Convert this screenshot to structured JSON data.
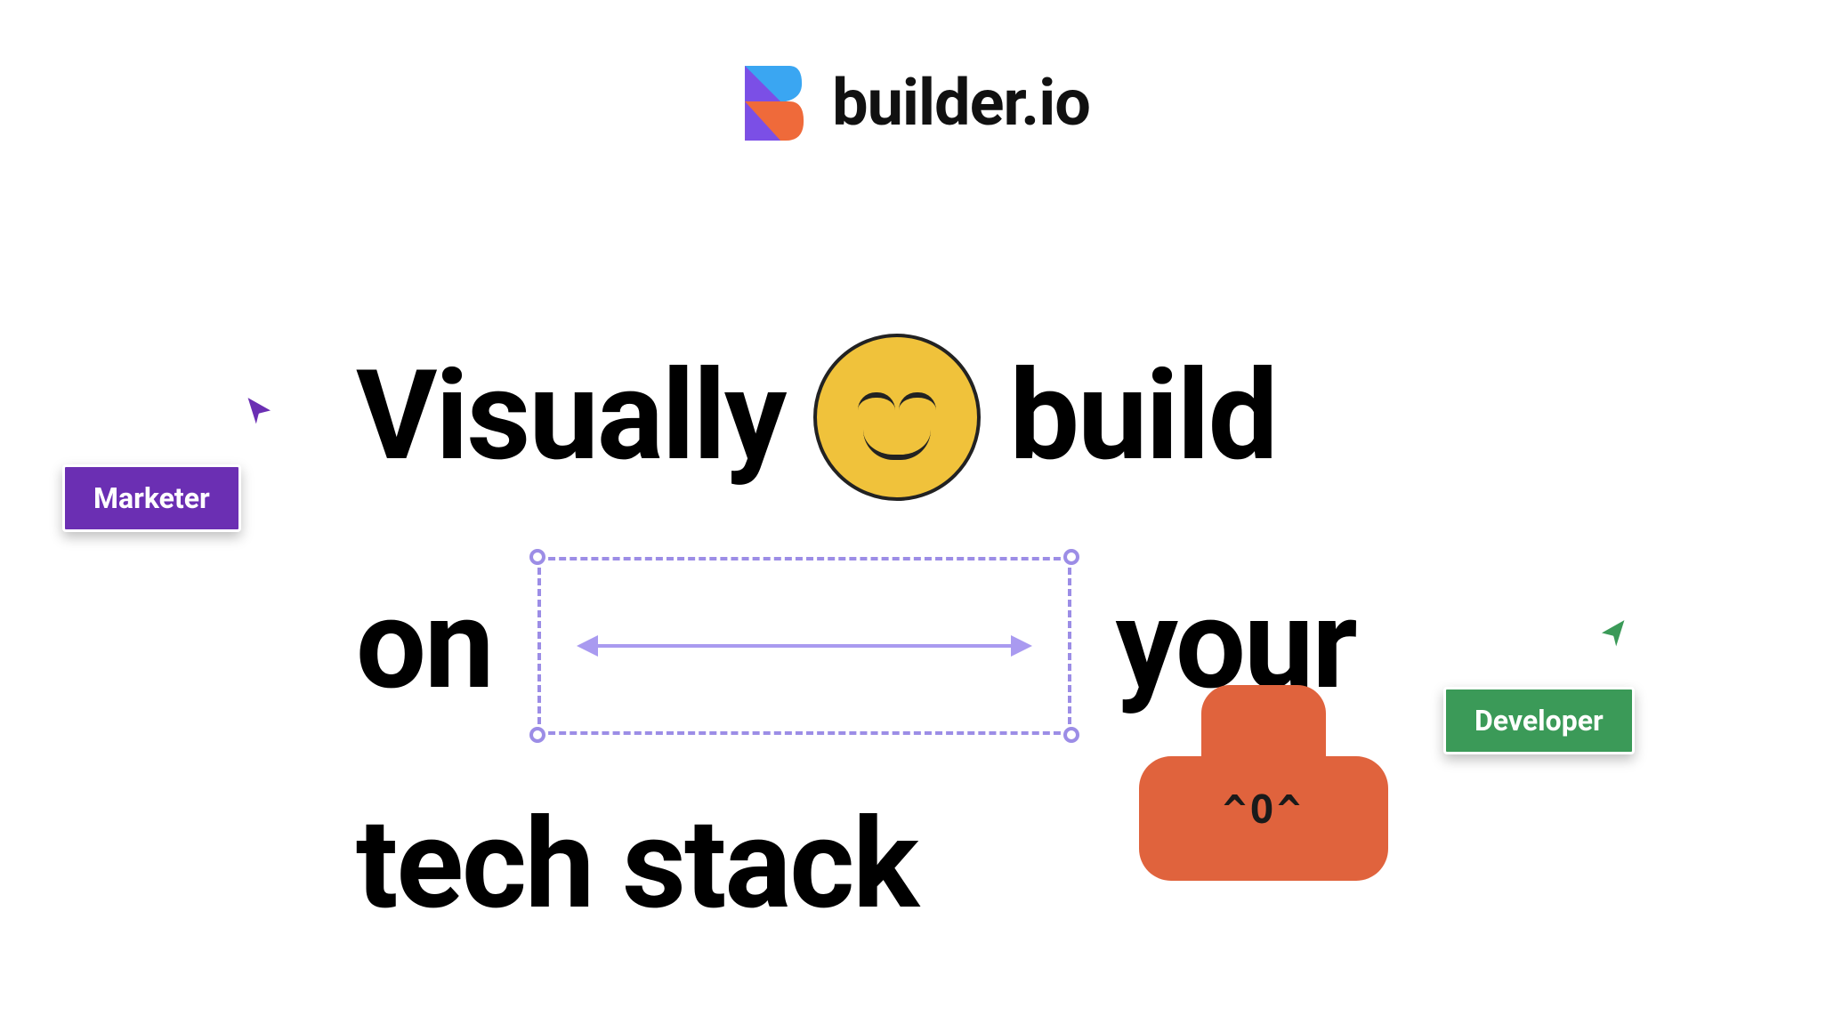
{
  "brand": {
    "name": "builder.io",
    "logo_colors": {
      "blue": "#3aa6f2",
      "purple": "#7b4fe6",
      "orange": "#ef6a3a"
    }
  },
  "headline": {
    "word1": "Visually",
    "word2": "build",
    "word3": "on",
    "word4": "your",
    "word5_6": "tech stack"
  },
  "blob": {
    "face_text": "^O^"
  },
  "cursors": {
    "marketer": {
      "label": "Marketer",
      "color": "#6b2fb3"
    },
    "developer": {
      "label": "Developer",
      "color": "#3b9a58"
    }
  },
  "selection_box": {
    "color": "#9c8de6"
  }
}
